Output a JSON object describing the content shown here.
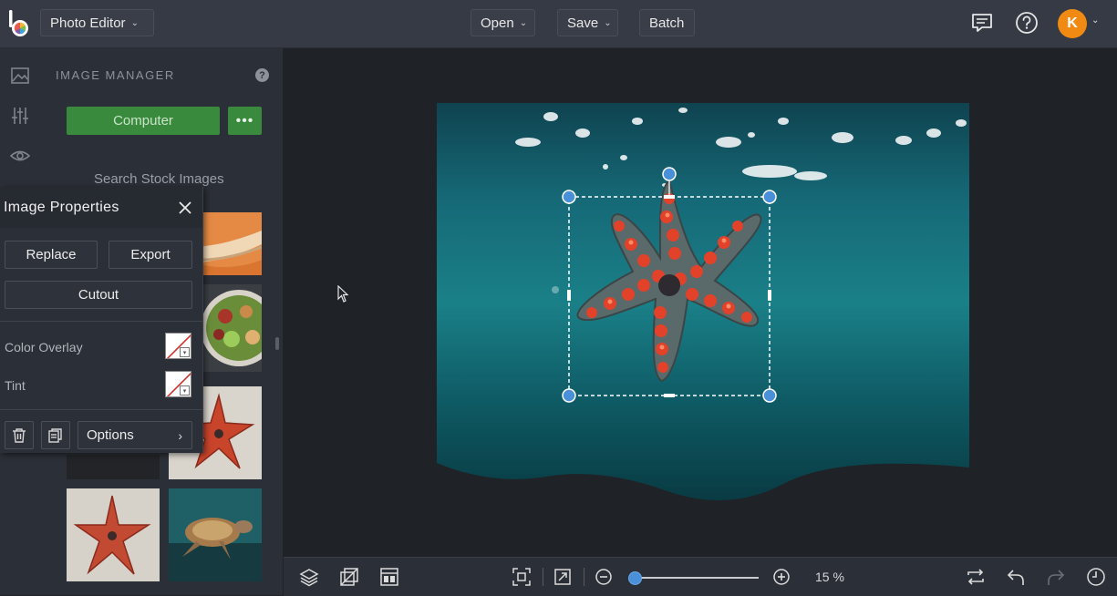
{
  "header": {
    "app_menu_label": "Photo Editor",
    "open_label": "Open",
    "save_label": "Save",
    "batch_label": "Batch",
    "avatar_initial": "K"
  },
  "image_manager": {
    "title": "IMAGE MANAGER",
    "help_glyph": "?",
    "computer_label": "Computer",
    "more_label": "•••",
    "search_stock_label": "Search Stock Images"
  },
  "image_properties": {
    "title": "Image Properties",
    "replace_label": "Replace",
    "export_label": "Export",
    "cutout_label": "Cutout",
    "color_overlay_label": "Color Overlay",
    "tint_label": "Tint",
    "options_label": "Options"
  },
  "bottom_bar": {
    "zoom_value": "15 %",
    "zoom_level_fraction": 0.0
  },
  "colors": {
    "accent_blue": "#4a90d9",
    "computer_green": "#3a8a3e",
    "avatar_orange": "#f08a12",
    "topbar": "#363a44",
    "panel": "#2b2f37",
    "canvas_bg": "#1f2227"
  },
  "icons": {
    "rail": [
      "image-icon",
      "sliders-icon",
      "eye-icon"
    ],
    "top_right": [
      "comment-icon",
      "help-icon"
    ],
    "bottom": [
      "layers-icon",
      "crop-arrange-icon",
      "layout-icon",
      "fit-screen-icon",
      "actual-size-icon",
      "zoom-out-icon",
      "zoom-in-icon",
      "flip-icon",
      "undo-icon",
      "redo-icon",
      "history-icon"
    ]
  }
}
